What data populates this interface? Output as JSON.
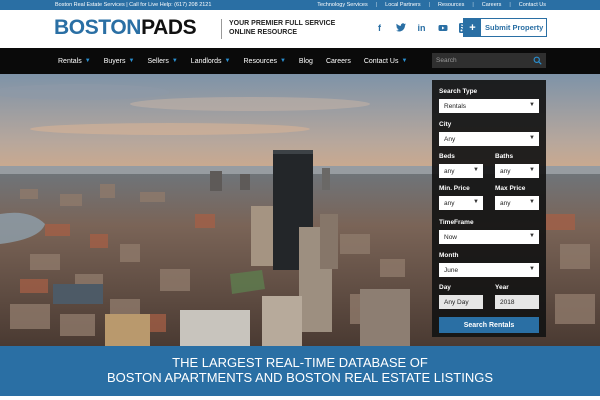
{
  "topbar": {
    "left_text": "Boston Real Estate Services | Call for Live Help: (617) 208 2121",
    "links": [
      "Technology Services",
      "Local Partners",
      "Resources",
      "Careers",
      "Contact Us"
    ]
  },
  "header": {
    "logo_part1": "BOSTON",
    "logo_part2": "PADS",
    "tagline_line1": "YOUR PREMIER FULL SERVICE",
    "tagline_line2": "ONLINE RESOURCE",
    "socials": [
      "facebook-icon",
      "twitter-icon",
      "linkedin-icon",
      "youtube-icon",
      "rss-icon"
    ],
    "submit_label": "Submit Property",
    "brand_color": "#2a6fa4"
  },
  "nav": {
    "items": [
      {
        "label": "Rentals",
        "dropdown": true
      },
      {
        "label": "Buyers",
        "dropdown": true
      },
      {
        "label": "Sellers",
        "dropdown": true
      },
      {
        "label": "Landlords",
        "dropdown": true
      },
      {
        "label": "Resources",
        "dropdown": true
      },
      {
        "label": "Blog",
        "dropdown": false
      },
      {
        "label": "Careers",
        "dropdown": false
      },
      {
        "label": "Contact Us",
        "dropdown": true
      }
    ],
    "search_placeholder": "Search"
  },
  "search_panel": {
    "search_type": {
      "label": "Search Type",
      "value": "Rentals"
    },
    "city": {
      "label": "City",
      "value": "Any"
    },
    "beds": {
      "label": "Beds",
      "value": "any"
    },
    "baths": {
      "label": "Baths",
      "value": "any"
    },
    "min_price": {
      "label": "Min. Price",
      "value": "any"
    },
    "max_price": {
      "label": "Max Price",
      "value": "any"
    },
    "timeframe": {
      "label": "TimeFrame",
      "value": "Now"
    },
    "month": {
      "label": "Month",
      "value": "June"
    },
    "day": {
      "label": "Day",
      "value": "Any Day"
    },
    "year": {
      "label": "Year",
      "value": "2018"
    },
    "button_label": "Search Rentals"
  },
  "banner": {
    "line1": "THE LARGEST REAL-TIME DATABASE OF",
    "line2": "BOSTON APARTMENTS AND BOSTON REAL ESTATE LISTINGS"
  }
}
